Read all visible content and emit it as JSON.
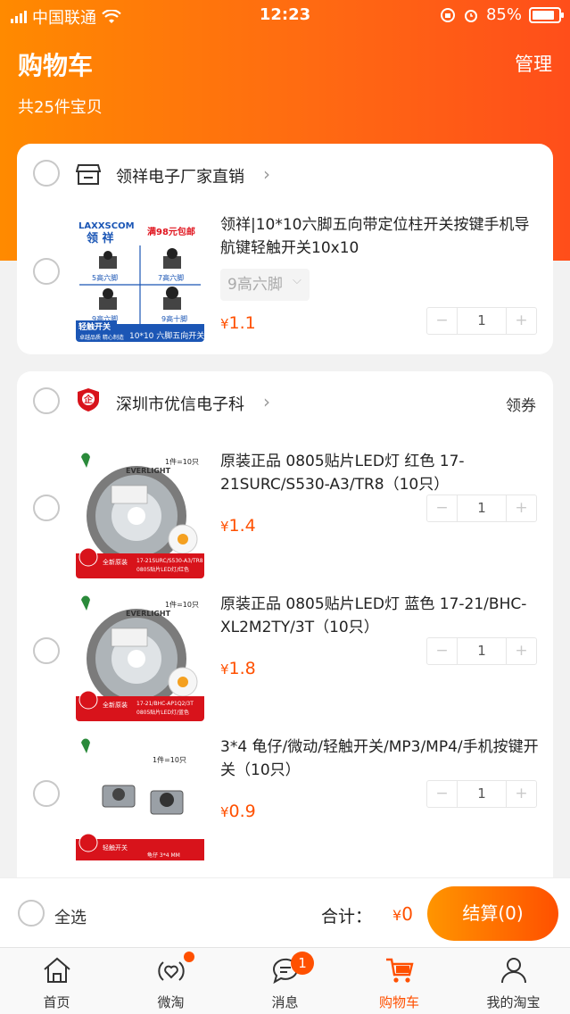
{
  "status_bar": {
    "carrier": "中国联通",
    "time": "12:23",
    "battery": "85%"
  },
  "header": {
    "title": "购物车",
    "subtitle": "共25件宝贝",
    "manage": "管理"
  },
  "shops": [
    {
      "name": "领祥电子厂家直销",
      "items": [
        {
          "title": "领祥|10*10六脚五向带定位柱开关按键手机导航键轻触开关10x10",
          "sku": "9高六脚",
          "currency": "¥",
          "price": "1.1",
          "qty": "1",
          "thumb": {
            "brand": "LAXXSCOM",
            "brand_cn": "领 祥",
            "promo": "满98元包邮",
            "cells": [
              "5高六脚",
              "7高六脚",
              "9高六脚",
              "9高十脚"
            ],
            "tag": "轻触开关",
            "bottom": "10*10 六脚五向开关",
            "slogan": "卓越品质 精心制造"
          }
        }
      ]
    },
    {
      "name": "深圳市优信电子科",
      "coupon": "领券",
      "items": [
        {
          "title": "原装正品 0805贴片LED灯 红色 17-21SURC/S530-A3/TR8（10只）",
          "currency": "¥",
          "price": "1.4",
          "qty": "1",
          "thumb": {
            "count": "1件=10只",
            "brand": "EVERLIGHT",
            "label1": "全新原装",
            "label2": "17-21SURC/S530-A3/TR8",
            "label3": "0805贴片LED灯/红色"
          }
        },
        {
          "title": "原装正品 0805贴片LED灯 蓝色 17-21/BHC-XL2M2TY/3T（10只）",
          "currency": "¥",
          "price": "1.8",
          "qty": "1",
          "thumb": {
            "count": "1件=10只",
            "brand": "EVERLIGHT",
            "label1": "全新原装",
            "label2": "17-21/BHC-AP1Q2/3T",
            "label3": "0805贴片LED灯/蓝色"
          }
        },
        {
          "title": "3*4 龟仔/微动/轻触开关/MP3/MP4/手机按键开关（10只）",
          "currency": "¥",
          "price": "0.9",
          "qty": "1",
          "thumb": {
            "count": "1件=10只",
            "label1": "轻触开关",
            "label2": "龟仔 3*4 MM"
          }
        }
      ]
    }
  ],
  "footer": {
    "select_all": "全选",
    "total_label": "合计：",
    "currency": "¥",
    "total": "0",
    "checkout": "结算(0)"
  },
  "tabs": [
    {
      "label": "首页",
      "icon": "home-icon"
    },
    {
      "label": "微淘",
      "icon": "weitao-icon"
    },
    {
      "label": "消息",
      "icon": "message-icon",
      "badge": "1"
    },
    {
      "label": "购物车",
      "icon": "cart-icon",
      "active": true
    },
    {
      "label": "我的淘宝",
      "icon": "user-icon"
    }
  ],
  "colors": {
    "accent": "#ff5000",
    "header_start": "#ff8a00",
    "header_end": "#ff4e1a"
  }
}
